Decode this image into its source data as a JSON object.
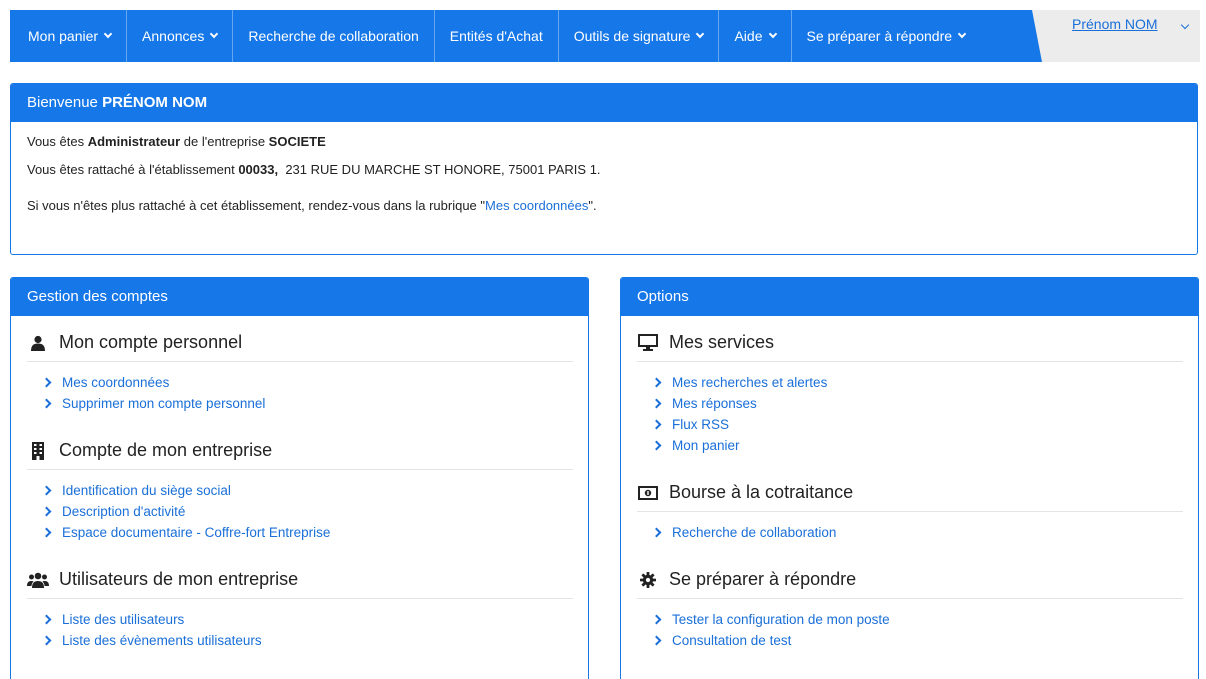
{
  "nav": {
    "items": [
      {
        "label": "Mon panier",
        "dropdown": true
      },
      {
        "label": "Annonces",
        "dropdown": true
      },
      {
        "label": "Recherche de collaboration",
        "dropdown": false
      },
      {
        "label": "Entités d'Achat",
        "dropdown": false
      },
      {
        "label": "Outils de signature",
        "dropdown": true
      },
      {
        "label": "Aide",
        "dropdown": true
      },
      {
        "label": "Se préparer à répondre",
        "dropdown": true
      }
    ],
    "user": "Prénom NOM"
  },
  "welcome": {
    "prefix": "Bienvenue ",
    "name": "PRÉNOM NOM",
    "line1_a": "Vous êtes ",
    "line1_role": "Administrateur",
    "line1_b": " de l'entreprise ",
    "line1_company": "SOCIETE",
    "line2_a": "Vous êtes rattaché à l'établissement ",
    "line2_code": "00033,",
    "line2_b": "  231 RUE DU MARCHE ST HONORE, 75001 PARIS 1.",
    "line3_a": "Si vous n'êtes plus rattaché à cet établissement, rendez-vous dans la rubrique \"",
    "line3_link": "Mes coordonnées",
    "line3_b": "\"."
  },
  "accounts": {
    "title": "Gestion des comptes",
    "sections": [
      {
        "title": "Mon compte personnel",
        "icon": "user-icon",
        "links": [
          "Mes coordonnées",
          "Supprimer mon compte personnel"
        ]
      },
      {
        "title": "Compte de mon entreprise",
        "icon": "building-icon",
        "links": [
          "Identification du siège social",
          "Description d'activité",
          "Espace documentaire - Coffre-fort Entreprise"
        ]
      },
      {
        "title": "Utilisateurs de mon entreprise",
        "icon": "users-icon",
        "links": [
          "Liste des utilisateurs",
          "Liste des évènements utilisateurs"
        ]
      }
    ]
  },
  "options": {
    "title": "Options",
    "sections": [
      {
        "title": "Mes services",
        "icon": "monitor-icon",
        "links": [
          "Mes recherches et alertes",
          "Mes réponses",
          "Flux RSS",
          "Mon panier"
        ]
      },
      {
        "title": "Bourse à la cotraitance",
        "icon": "money-icon",
        "links": [
          "Recherche de collaboration"
        ]
      },
      {
        "title": "Se préparer à répondre",
        "icon": "gear-icon",
        "links": [
          "Tester la configuration de mon poste",
          "Consultation de test"
        ]
      }
    ]
  },
  "colors": {
    "primary": "#1677e8",
    "link": "#1a6fd8"
  }
}
